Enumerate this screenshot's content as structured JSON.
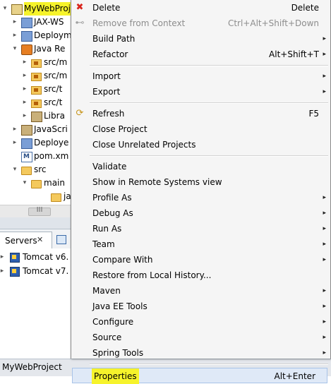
{
  "explorer": {
    "items": [
      {
        "twisty": "▾",
        "label": "MyWebProject",
        "icon": "project-icon"
      },
      {
        "twisty": "▸",
        "label": "JAX-WS",
        "icon": "webservices-icon"
      },
      {
        "twisty": "▸",
        "label": "Deploym",
        "icon": "deployment-descriptor-icon"
      },
      {
        "twisty": "▾",
        "label": "Java Re",
        "icon": "java-resources-icon"
      },
      {
        "twisty": "▸",
        "label": "src/m",
        "icon": "source-folder-icon"
      },
      {
        "twisty": "▸",
        "label": "src/m",
        "icon": "source-folder-icon"
      },
      {
        "twisty": "▸",
        "label": "src/t",
        "icon": "source-folder-icon"
      },
      {
        "twisty": "▸",
        "label": "src/t",
        "icon": "source-folder-icon"
      },
      {
        "twisty": "▸",
        "label": "Libra",
        "icon": "library-icon"
      },
      {
        "twisty": "▸",
        "label": "JavaScri",
        "icon": "javascript-resources-icon"
      },
      {
        "twisty": "▸",
        "label": "Deploye",
        "icon": "deployed-resources-icon"
      },
      {
        "twisty": "",
        "label": "pom.xm",
        "icon": "maven-pom-icon"
      },
      {
        "twisty": "▾",
        "label": "src",
        "icon": "folder-icon"
      },
      {
        "twisty": "▾",
        "label": "main",
        "icon": "folder-icon"
      },
      {
        "twisty": "",
        "label": "ja",
        "icon": "folder-icon"
      }
    ]
  },
  "hscroll": {
    "grip": "III"
  },
  "servers": {
    "tab_label": "Servers",
    "tab_close": "✕",
    "items": [
      {
        "label": "Tomcat v6.",
        "icon": "server-icon"
      },
      {
        "label": "Tomcat v7.",
        "icon": "server-icon"
      }
    ]
  },
  "status": {
    "text": "MyWebProject"
  },
  "menu": {
    "items": [
      {
        "label": "Delete",
        "shortcut": "Delete",
        "submenu": false,
        "disabled": false,
        "icon": "delete-icon"
      },
      {
        "label": "Remove from Context",
        "shortcut": "Ctrl+Alt+Shift+Down",
        "submenu": false,
        "disabled": true,
        "icon": "remove-context-icon"
      },
      {
        "label": "Build Path",
        "shortcut": "",
        "submenu": true,
        "disabled": false,
        "icon": ""
      },
      {
        "label": "Refactor",
        "shortcut": "Alt+Shift+T",
        "submenu": true,
        "disabled": false,
        "icon": ""
      },
      {
        "separator": true
      },
      {
        "label": "Import",
        "shortcut": "",
        "submenu": true,
        "disabled": false,
        "icon": ""
      },
      {
        "label": "Export",
        "shortcut": "",
        "submenu": true,
        "disabled": false,
        "icon": ""
      },
      {
        "separator": true
      },
      {
        "label": "Refresh",
        "shortcut": "F5",
        "submenu": false,
        "disabled": false,
        "icon": "refresh-icon"
      },
      {
        "label": "Close Project",
        "shortcut": "",
        "submenu": false,
        "disabled": false,
        "icon": ""
      },
      {
        "label": "Close Unrelated Projects",
        "shortcut": "",
        "submenu": false,
        "disabled": false,
        "icon": ""
      },
      {
        "separator": true
      },
      {
        "label": "Validate",
        "shortcut": "",
        "submenu": false,
        "disabled": false,
        "icon": ""
      },
      {
        "label": "Show in Remote Systems view",
        "shortcut": "",
        "submenu": false,
        "disabled": false,
        "icon": ""
      },
      {
        "label": "Profile As",
        "shortcut": "",
        "submenu": true,
        "disabled": false,
        "icon": ""
      },
      {
        "label": "Debug As",
        "shortcut": "",
        "submenu": true,
        "disabled": false,
        "icon": ""
      },
      {
        "label": "Run As",
        "shortcut": "",
        "submenu": true,
        "disabled": false,
        "icon": ""
      },
      {
        "label": "Team",
        "shortcut": "",
        "submenu": true,
        "disabled": false,
        "icon": ""
      },
      {
        "label": "Compare With",
        "shortcut": "",
        "submenu": true,
        "disabled": false,
        "icon": ""
      },
      {
        "label": "Restore from Local History...",
        "shortcut": "",
        "submenu": false,
        "disabled": false,
        "icon": ""
      },
      {
        "label": "Maven",
        "shortcut": "",
        "submenu": true,
        "disabled": false,
        "icon": ""
      },
      {
        "label": "Java EE Tools",
        "shortcut": "",
        "submenu": true,
        "disabled": false,
        "icon": ""
      },
      {
        "label": "Configure",
        "shortcut": "",
        "submenu": true,
        "disabled": false,
        "icon": ""
      },
      {
        "label": "Source",
        "shortcut": "",
        "submenu": true,
        "disabled": false,
        "icon": ""
      },
      {
        "label": "Spring Tools",
        "shortcut": "",
        "submenu": true,
        "disabled": false,
        "icon": ""
      },
      {
        "separator": true
      },
      {
        "label": "Properties",
        "shortcut": "Alt+Enter",
        "submenu": false,
        "disabled": false,
        "icon": "",
        "selected": true
      }
    ]
  },
  "colors": {
    "highlight": "#f6f32b",
    "menu_bg": "#f5f5f5",
    "disabled_text": "#8d8d8d"
  }
}
